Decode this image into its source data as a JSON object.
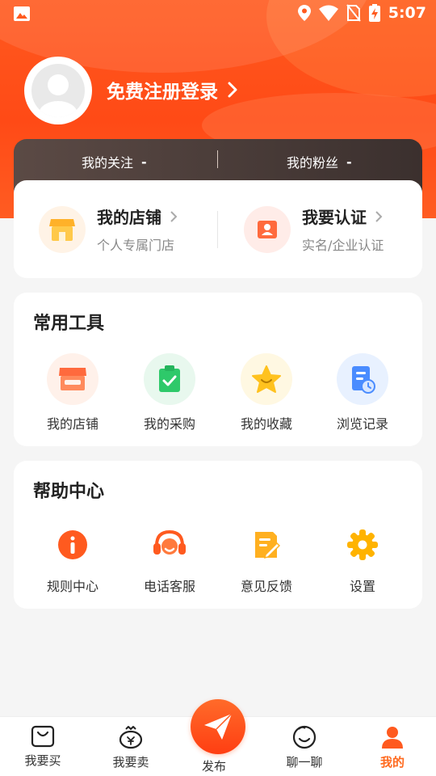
{
  "status_bar": {
    "time": "5:07"
  },
  "profile": {
    "login_text": "免费注册登录"
  },
  "follow": {
    "following_label": "我的关注",
    "following_value": "-",
    "followers_label": "我的粉丝",
    "followers_value": "-"
  },
  "store_card": {
    "my_store_title": "我的店铺",
    "my_store_sub": "个人专属门店",
    "verify_title": "我要认证",
    "verify_sub": "实名/企业认证"
  },
  "tools": {
    "title": "常用工具",
    "items": [
      {
        "label": "我的店铺",
        "icon": "shop-icon"
      },
      {
        "label": "我的采购",
        "icon": "purchase-clipboard-icon"
      },
      {
        "label": "我的收藏",
        "icon": "star-icon"
      },
      {
        "label": "浏览记录",
        "icon": "history-icon"
      }
    ]
  },
  "help": {
    "title": "帮助中心",
    "items": [
      {
        "label": "规则中心",
        "icon": "info-icon"
      },
      {
        "label": "电话客服",
        "icon": "headset-icon"
      },
      {
        "label": "意见反馈",
        "icon": "feedback-icon"
      },
      {
        "label": "设置",
        "icon": "gear-icon"
      }
    ]
  },
  "tabbar": {
    "buy": "我要买",
    "sell": "我要卖",
    "publish": "发布",
    "chat": "聊一聊",
    "mine": "我的"
  },
  "colors": {
    "accent": "#ff5a1f",
    "active_tab": "#ff6a1f"
  }
}
